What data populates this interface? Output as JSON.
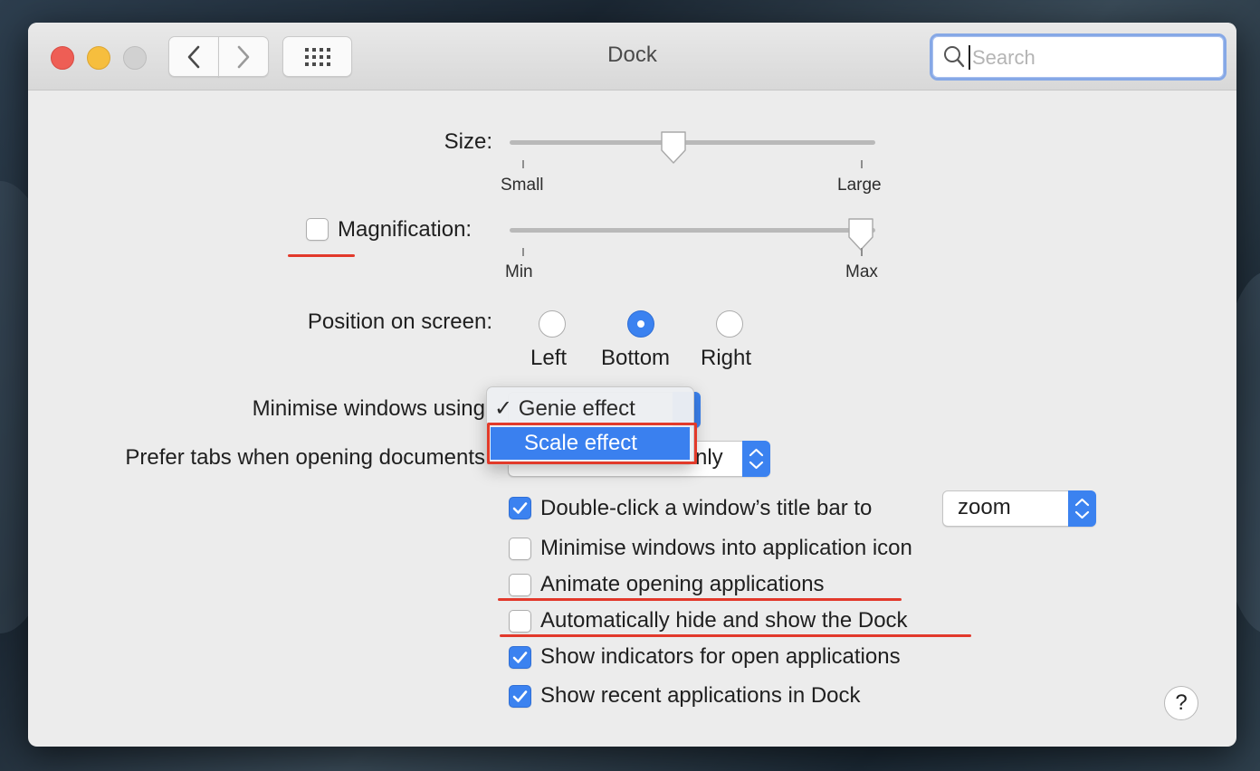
{
  "window": {
    "title": "Dock"
  },
  "search": {
    "placeholder": "Search"
  },
  "size": {
    "label": "Size:",
    "min_label": "Small",
    "max_label": "Large",
    "value": 0.45
  },
  "magnification": {
    "label": "Magnification:",
    "checked": false,
    "min_label": "Min",
    "max_label": "Max",
    "value": 0.96
  },
  "position": {
    "label": "Position on screen:",
    "options": [
      "Left",
      "Bottom",
      "Right"
    ],
    "selected": "Bottom"
  },
  "minimise": {
    "label": "Minimise windows using",
    "menu": {
      "selected_item": "Genie effect",
      "highlighted_item": "Scale effect"
    }
  },
  "prefer_tabs": {
    "label": "Prefer tabs when opening documents",
    "value_fragment": "nly"
  },
  "double_click": {
    "label": "Double-click a window’s title bar to",
    "checked": true,
    "value": "zoom"
  },
  "checkboxes": [
    {
      "label": "Minimise windows into application icon",
      "checked": false
    },
    {
      "label": "Animate opening applications",
      "checked": false
    },
    {
      "label": "Automatically hide and show the Dock",
      "checked": false
    },
    {
      "label": "Show indicators for open applications",
      "checked": true
    },
    {
      "label": "Show recent applications in Dock",
      "checked": true
    }
  ],
  "help": {
    "label": "?"
  },
  "colors": {
    "accent": "#3b82f0",
    "annotation": "#e2392b"
  },
  "icons": [
    "back-chevron-icon",
    "forward-chevron-icon",
    "grid-icon",
    "search-icon",
    "checkmark-icon",
    "updown-arrows-icon"
  ]
}
